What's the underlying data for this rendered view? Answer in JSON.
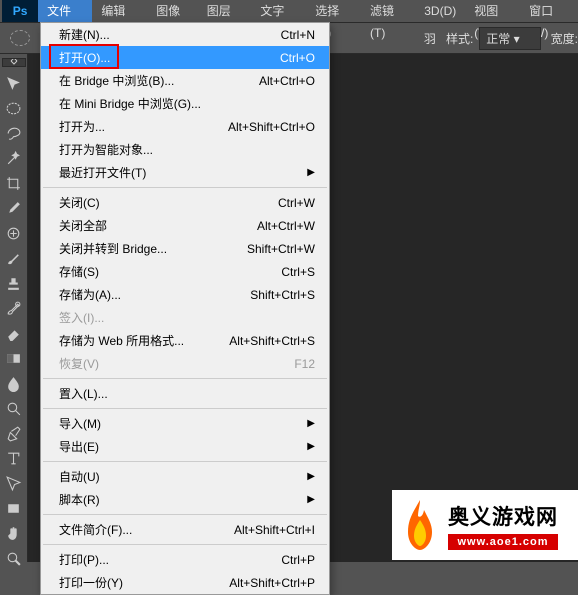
{
  "menubar": {
    "logo": "Ps",
    "items": [
      {
        "label": "文件(F)",
        "active": true
      },
      {
        "label": "编辑(E)"
      },
      {
        "label": "图像(I)"
      },
      {
        "label": "图层(L)"
      },
      {
        "label": "文字(Y)"
      },
      {
        "label": "选择(S)"
      },
      {
        "label": "滤镜(T)"
      },
      {
        "label": "3D(D)"
      },
      {
        "label": "视图(V)"
      },
      {
        "label": "窗口(W)"
      }
    ]
  },
  "options": {
    "feather_label": "羽",
    "style_label": "样式:",
    "style_value": "正常",
    "width_label": "宽度:"
  },
  "dropdown_groups": [
    [
      {
        "label": "新建(N)...",
        "shortcut": "Ctrl+N"
      },
      {
        "label": "打开(O)...",
        "shortcut": "Ctrl+O",
        "highlighted": true,
        "boxed": true
      },
      {
        "label": "在 Bridge 中浏览(B)...",
        "shortcut": "Alt+Ctrl+O"
      },
      {
        "label": "在 Mini Bridge 中浏览(G)..."
      },
      {
        "label": "打开为...",
        "shortcut": "Alt+Shift+Ctrl+O"
      },
      {
        "label": "打开为智能对象..."
      },
      {
        "label": "最近打开文件(T)",
        "submenu": true
      }
    ],
    [
      {
        "label": "关闭(C)",
        "shortcut": "Ctrl+W"
      },
      {
        "label": "关闭全部",
        "shortcut": "Alt+Ctrl+W"
      },
      {
        "label": "关闭并转到 Bridge...",
        "shortcut": "Shift+Ctrl+W"
      },
      {
        "label": "存储(S)",
        "shortcut": "Ctrl+S"
      },
      {
        "label": "存储为(A)...",
        "shortcut": "Shift+Ctrl+S"
      },
      {
        "label": "签入(I)...",
        "disabled": true
      },
      {
        "label": "存储为 Web 所用格式...",
        "shortcut": "Alt+Shift+Ctrl+S"
      },
      {
        "label": "恢复(V)",
        "shortcut": "F12",
        "disabled": true
      }
    ],
    [
      {
        "label": "置入(L)..."
      }
    ],
    [
      {
        "label": "导入(M)",
        "submenu": true
      },
      {
        "label": "导出(E)",
        "submenu": true
      }
    ],
    [
      {
        "label": "自动(U)",
        "submenu": true
      },
      {
        "label": "脚本(R)",
        "submenu": true
      }
    ],
    [
      {
        "label": "文件简介(F)...",
        "shortcut": "Alt+Shift+Ctrl+I"
      }
    ],
    [
      {
        "label": "打印(P)...",
        "shortcut": "Ctrl+P"
      },
      {
        "label": "打印一份(Y)",
        "shortcut": "Alt+Shift+Ctrl+P"
      }
    ]
  ],
  "watermark": {
    "cn": "奥义游戏网",
    "url": "www.aoe1.com"
  },
  "tools": [
    "move",
    "marquee",
    "lasso",
    "wand",
    "crop",
    "eyedropper",
    "heal",
    "brush",
    "stamp",
    "history",
    "eraser",
    "gradient",
    "blur",
    "dodge",
    "pen",
    "type",
    "path",
    "rect",
    "hand",
    "zoom"
  ]
}
